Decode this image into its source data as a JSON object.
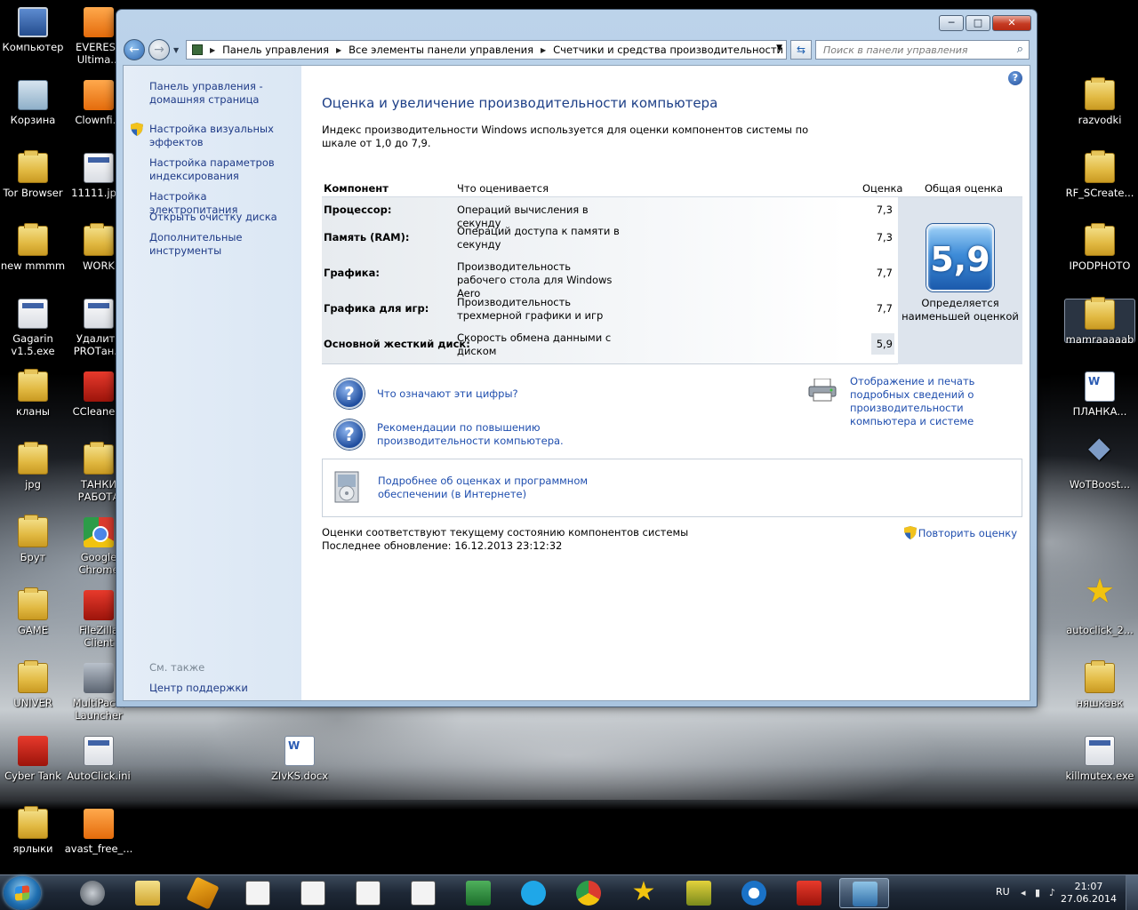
{
  "desktop": {
    "left_col1": [
      {
        "label": "Компьютер",
        "icon": "computer-icon"
      },
      {
        "label": "Корзина",
        "icon": "recycle-bin-icon"
      },
      {
        "label": "Tor Browser",
        "icon": "folder-icon"
      },
      {
        "label": "new mmmm",
        "icon": "folder-icon"
      },
      {
        "label": "Gagarin v1.5.exe",
        "icon": "exe-icon"
      },
      {
        "label": "кланы",
        "icon": "folder-icon"
      },
      {
        "label": "jpg",
        "icon": "folder-icon"
      },
      {
        "label": "Брут",
        "icon": "folder-icon"
      },
      {
        "label": "GAME",
        "icon": "folder-icon"
      },
      {
        "label": "UNIVER",
        "icon": "folder-icon"
      },
      {
        "label": "Cyber Tank",
        "icon": "exe-icon"
      },
      {
        "label": "ярлыки",
        "icon": "folder-icon"
      }
    ],
    "left_col2": [
      {
        "label": "EVEREST Ultima...",
        "icon": "everest-icon"
      },
      {
        "label": "Clownfi...",
        "icon": "clownfish-icon"
      },
      {
        "label": "11111.jp...",
        "icon": "image-file-icon"
      },
      {
        "label": "WORK",
        "icon": "folder-icon"
      },
      {
        "label": "Удалить PROTан...",
        "icon": "exe-icon"
      },
      {
        "label": "CCleane...",
        "icon": "ccleaner-icon"
      },
      {
        "label": "ТАНКИ РАБОТА",
        "icon": "folder-icon"
      },
      {
        "label": "Google Chrome",
        "icon": "chrome-icon"
      },
      {
        "label": "FileZilla Client",
        "icon": "filezilla-icon"
      },
      {
        "label": "MultiPac... Launcher",
        "icon": "tank-icon"
      },
      {
        "label": "AutoClick.ini",
        "icon": "ini-file-icon"
      },
      {
        "label": "avast_free_...",
        "icon": "avast-icon"
      }
    ],
    "center_file": {
      "label": "ZIvKS.docx",
      "icon": "word-doc-icon"
    },
    "right_col": [
      {
        "label": "razvodki",
        "icon": "folder-icon"
      },
      {
        "label": "RF_SCreate...",
        "icon": "folder-icon"
      },
      {
        "label": "IPODPHOTO",
        "icon": "folder-icon"
      },
      {
        "label": "mamraaaaab",
        "icon": "folder-icon"
      },
      {
        "label": "ПЛАНКА...",
        "icon": "word-doc-icon"
      },
      {
        "label": "WoTBoost...",
        "icon": "gem-icon"
      },
      {
        "label": "autoclick_2...",
        "icon": "star-icon"
      },
      {
        "label": "няшкавк",
        "icon": "folder-icon"
      },
      {
        "label": "killmutex.exe",
        "icon": "exe-icon"
      }
    ]
  },
  "window": {
    "breadcrumb": [
      "Панель управления",
      "Все элементы панели управления",
      "Счетчики и средства производительности"
    ],
    "search_placeholder": "Поиск в панели управления",
    "controls": {
      "minimize": "─",
      "maximize": "□",
      "close": "✕"
    }
  },
  "sidebar": {
    "home": "Панель управления - домашняя страница",
    "links": [
      "Настройка визуальных эффектов",
      "Настройка параметров индексирования",
      "Настройка электропитания",
      "Открыть очистку диска",
      "Дополнительные инструменты"
    ],
    "see_also": "См. также",
    "support": "Центр поддержки"
  },
  "main": {
    "title": "Оценка и увеличение производительности компьютера",
    "intro": "Индекс производительности Windows используется для оценки компонентов системы по шкале от 1,0 до 7,9.",
    "table": {
      "headers": {
        "component": "Компонент",
        "what": "Что оценивается",
        "score": "Оценка",
        "overall": "Общая оценка"
      },
      "rows": [
        {
          "component": "Процессор:",
          "what": "Операций вычисления в секунду",
          "score": "7,3"
        },
        {
          "component": "Память (RAM):",
          "what": "Операций доступа к памяти в секунду",
          "score": "7,3"
        },
        {
          "component": "Графика:",
          "what": "Производительность рабочего стола для Windows Aero",
          "score": "7,7"
        },
        {
          "component": "Графика для игр:",
          "what": "Производительность трехмерной графики и игр",
          "score": "7,7"
        },
        {
          "component": "Основной жесткий диск:",
          "what": "Скорость обмена данными с диском",
          "score": "5,9"
        }
      ],
      "overall_score": "5,9",
      "overall_note": "Определяется наименьшей оценкой"
    },
    "links": {
      "what_numbers": "Что означают эти цифры?",
      "tips": "Рекомендации по повышению производительности компьютера.",
      "print": "Отображение и печать подробных сведений о производительности компьютера и системе",
      "online": "Подробнее об оценках и программном обеспечении (в Интернете)"
    },
    "status_line1": "Оценки соответствуют текущему состоянию компонентов системы",
    "status_line2": "Последнее обновление: 16.12.2013 23:12:32",
    "rerun": "Повторить оценку"
  },
  "taskbar": {
    "lang": "RU",
    "time": "21:07",
    "date": "27.06.2014",
    "apps": [
      "world-of-tanks-icon",
      "explorer-icon",
      "winamp-icon",
      "exe-icon",
      "exe-icon",
      "exe-icon",
      "exe-icon",
      "excel-icon",
      "skype-icon",
      "chrome-icon",
      "star-icon",
      "game-icon",
      "teamviewer-icon",
      "filezilla-icon",
      "control-panel-icon"
    ]
  }
}
